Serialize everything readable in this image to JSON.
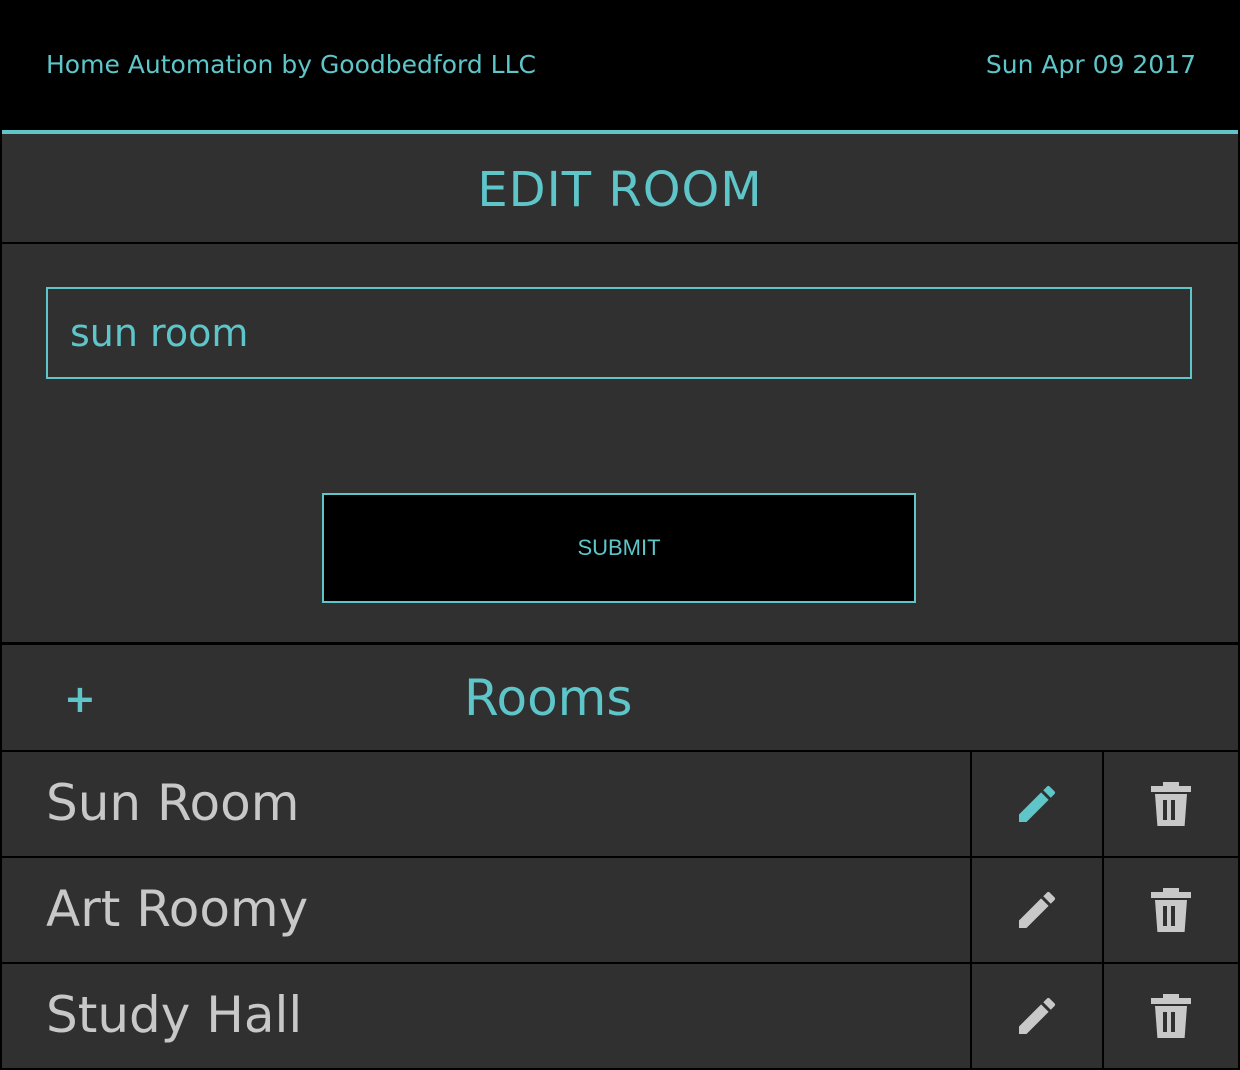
{
  "header": {
    "title": "Home Automation by Goodbedford LLC",
    "date": "Sun Apr 09 2017"
  },
  "edit_room": {
    "heading": "EDIT ROOM",
    "input_value": "sun room",
    "submit_label": "SUBMIT"
  },
  "rooms": {
    "add_label": "+",
    "heading": "Rooms",
    "items": [
      {
        "name": "Sun Room",
        "edit_active": true
      },
      {
        "name": "Art Roomy",
        "edit_active": false
      },
      {
        "name": "Study Hall",
        "edit_active": false
      }
    ],
    "edit_icon": "pencil-icon",
    "delete_icon": "trash-icon"
  },
  "colors": {
    "accent": "#5ec5c9",
    "background": "#303030",
    "header_bg": "#000000",
    "room_text": "#c8c8c8",
    "icon_inactive": "#c8c8c8"
  }
}
